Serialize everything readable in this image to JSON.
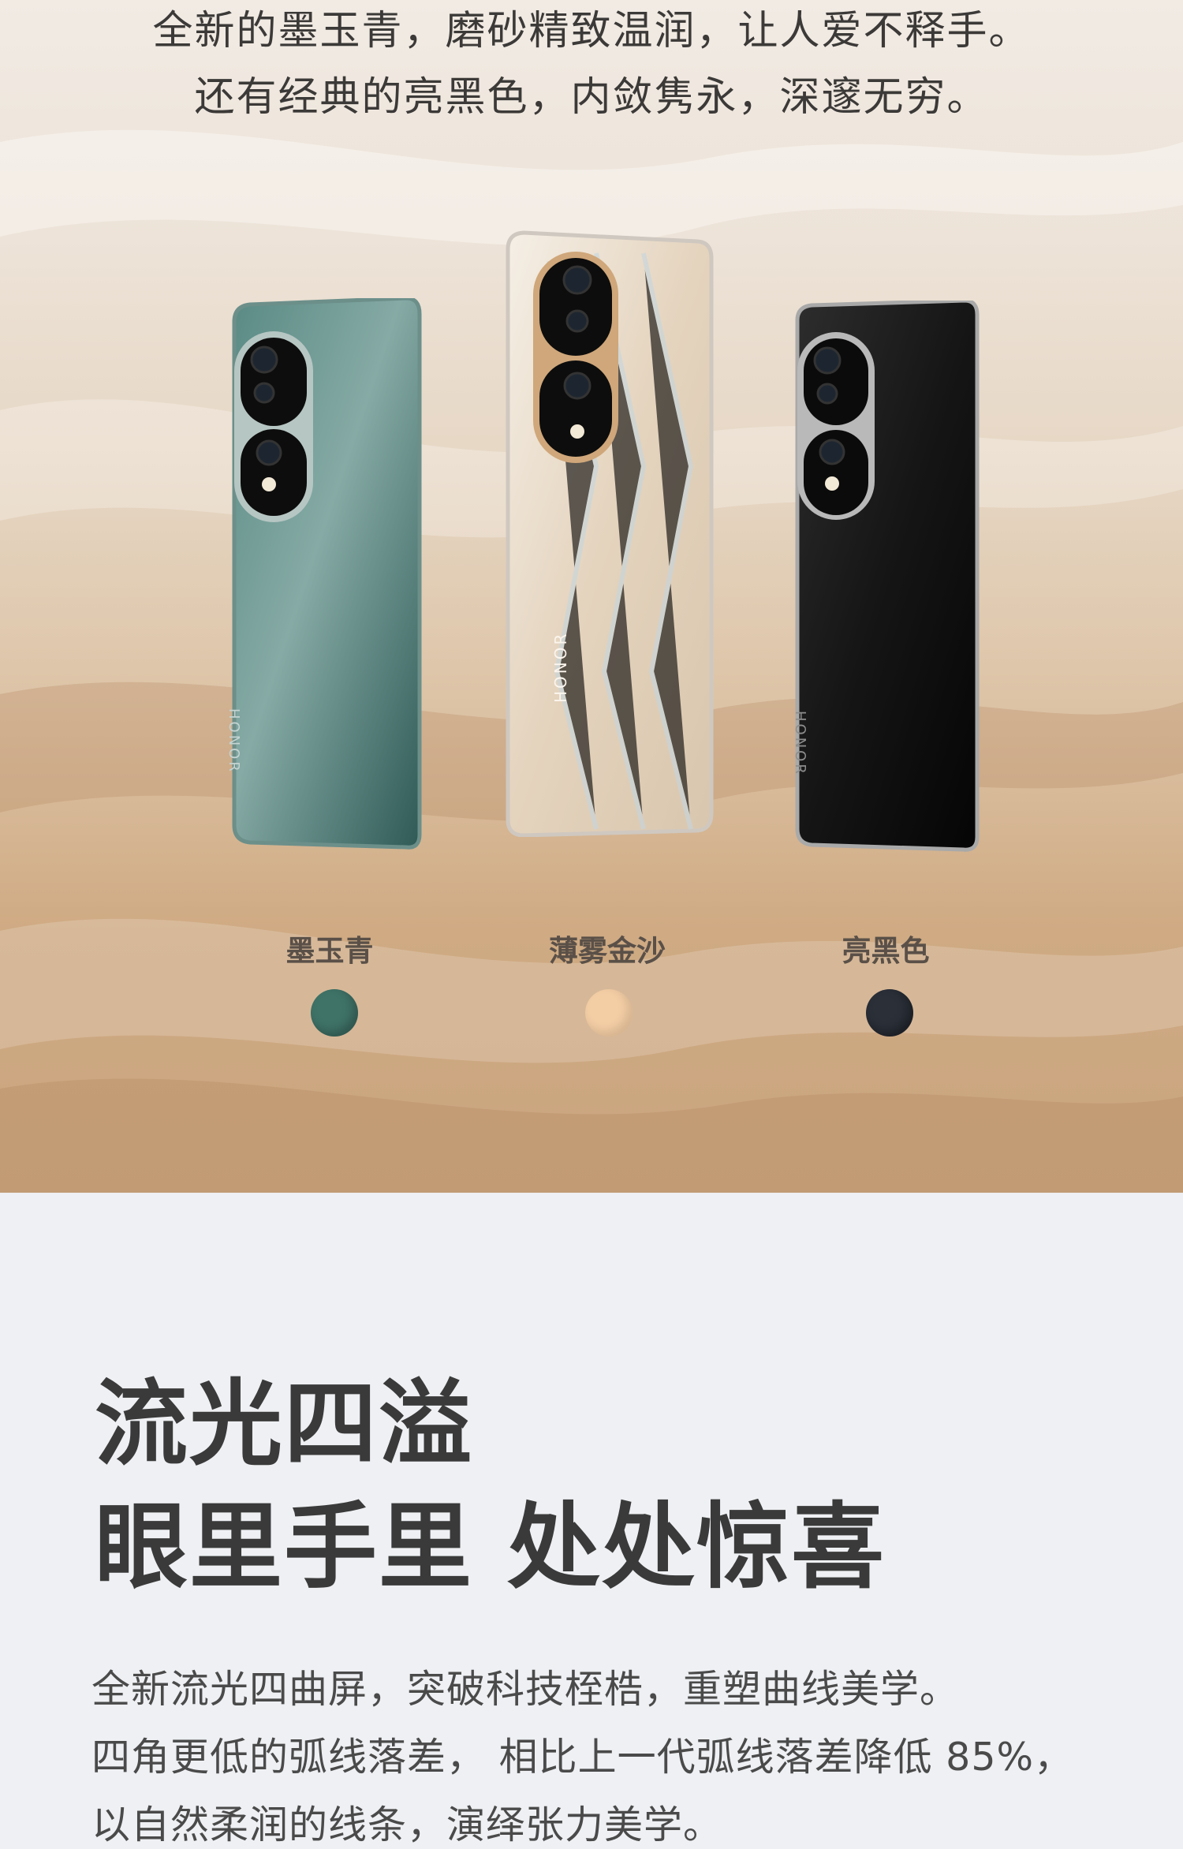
{
  "intro": {
    "line1": "全新的墨玉青，磨砂精致温润，让人爱不释手。",
    "line2": "还有经典的亮黑色，内敛隽永，深邃无穷。"
  },
  "phones": [
    {
      "brand": "HONOR",
      "name": "墨玉青",
      "body_color": "#3d6b67",
      "swatch_color": "#3f7368"
    },
    {
      "brand": "HONOR",
      "name": "薄雾金沙",
      "body_color": "#e9dccb",
      "swatch_color": "#f3cda4"
    },
    {
      "brand": "HONOR",
      "name": "亮黑色",
      "body_color": "#141414",
      "swatch_color": "#2a2f38"
    }
  ],
  "feature": {
    "headline_line1": "流光四溢",
    "headline_line2": "眼里手里 处处惊喜",
    "body_line1": "全新流光四曲屏，突破科技桎梏，重塑曲线美学。",
    "body_line2": "四角更低的弧线落差， 相比上一代弧线落差降低 85%，",
    "body_line3": "以自然柔润的线条，演绎张力美学。"
  }
}
